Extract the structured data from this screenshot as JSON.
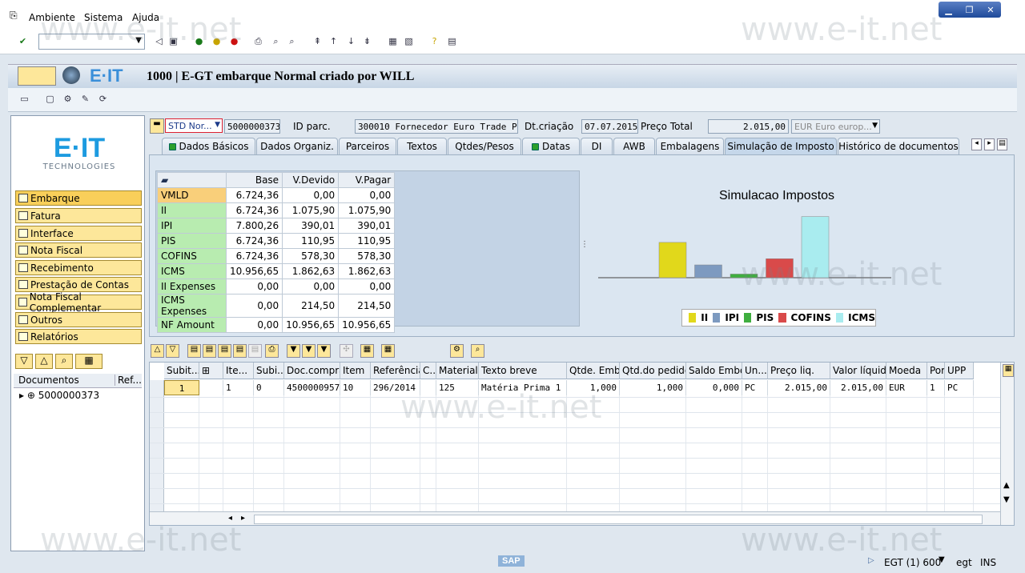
{
  "menu": {
    "items": [
      "Ambiente",
      "Sistema",
      "Ajuda"
    ]
  },
  "title": {
    "text": "1000 | E-GT embarque Normal criado por WILL",
    "brand": "E·IT"
  },
  "logo": {
    "main": "E·IT",
    "sub": "TECHNOLOGIES"
  },
  "nav": {
    "items": [
      "Embarque",
      "Fatura",
      "Interface",
      "Nota Fiscal",
      "Recebimento",
      "Prestação de Contas",
      "Nota Fiscal Complementar",
      "Outros",
      "Relatórios"
    ]
  },
  "tree": {
    "col1": "Documentos",
    "col2": "Ref...",
    "node": "5000000373"
  },
  "header": {
    "doc_type": "STD Nor...",
    "doc_number": "5000000373",
    "id_parc_label": "ID parc.",
    "id_parc_value": "300010 Fornecedor Euro Trade P",
    "dt_label": "Dt.criação",
    "dt_value": "07.07.2015",
    "price_label": "Preço Total",
    "price_value": "2.015,00",
    "currency": "EUR Euro europ..."
  },
  "tabs": [
    {
      "label": "Dados Básicos",
      "dot": true
    },
    {
      "label": "Dados Organiz.",
      "dot": false
    },
    {
      "label": "Parceiros",
      "dot": false
    },
    {
      "label": "Textos",
      "dot": false
    },
    {
      "label": "Qtdes/Pesos",
      "dot": false
    },
    {
      "label": "Datas",
      "dot": true
    },
    {
      "label": "DI",
      "dot": false
    },
    {
      "label": "AWB",
      "dot": false
    },
    {
      "label": "Embalagens",
      "dot": false
    },
    {
      "label": "Simulação de Imposto",
      "dot": false
    },
    {
      "label": "Histórico de documentos",
      "dot": false
    }
  ],
  "tax": {
    "headers": [
      "Base",
      "V.Devido",
      "V.Pagar"
    ],
    "rows": [
      [
        "VMLD",
        "6.724,36",
        "0,00",
        "0,00"
      ],
      [
        "II",
        "6.724,36",
        "1.075,90",
        "1.075,90"
      ],
      [
        "IPI",
        "7.800,26",
        "390,01",
        "390,01"
      ],
      [
        "PIS",
        "6.724,36",
        "110,95",
        "110,95"
      ],
      [
        "COFINS",
        "6.724,36",
        "578,30",
        "578,30"
      ],
      [
        "ICMS",
        "10.956,65",
        "1.862,63",
        "1.862,63"
      ],
      [
        "II Expenses",
        "0,00",
        "0,00",
        "0,00"
      ],
      [
        "ICMS Expenses",
        "0,00",
        "214,50",
        "214,50"
      ],
      [
        "NF Amount",
        "0,00",
        "10.956,65",
        "10.956,65"
      ]
    ]
  },
  "chart_data": {
    "type": "bar",
    "title": "Simulacao Impostos",
    "categories": [
      "II",
      "IPI",
      "PIS",
      "COFINS",
      "ICMS"
    ],
    "values": [
      1075.9,
      390.01,
      110.95,
      578.3,
      1862.63
    ],
    "colors": [
      "#e1d81b",
      "#7d9ac0",
      "#3fae3f",
      "#d94a4a",
      "#a9ecef"
    ],
    "ylim": [
      0,
      2000
    ],
    "legend": "bottom"
  },
  "grid": {
    "headers": [
      "Subit...",
      "",
      "Ite...",
      "Subi...",
      "Doc.compras",
      "Item",
      "Referência",
      "C...",
      "Material",
      "Texto breve",
      "Qtde. Emb",
      "Qtd.do pedido",
      "Saldo Embq",
      "Un...",
      "Preço liq.",
      "Valor líquido",
      "Moeda",
      "Por",
      "UPP"
    ],
    "row": [
      "1",
      "",
      "1",
      "0",
      "4500000957",
      "10",
      "296/2014",
      "",
      "125",
      "Matéria Prima 1",
      "1,000",
      "1,000",
      "0,000",
      "PC",
      "2.015,00",
      "2.015,00",
      "EUR",
      "1",
      "PC"
    ]
  },
  "status": {
    "system": "EGT (1) 600",
    "user": "egt",
    "mode": "INS"
  },
  "watermark": "www.e-it.net"
}
